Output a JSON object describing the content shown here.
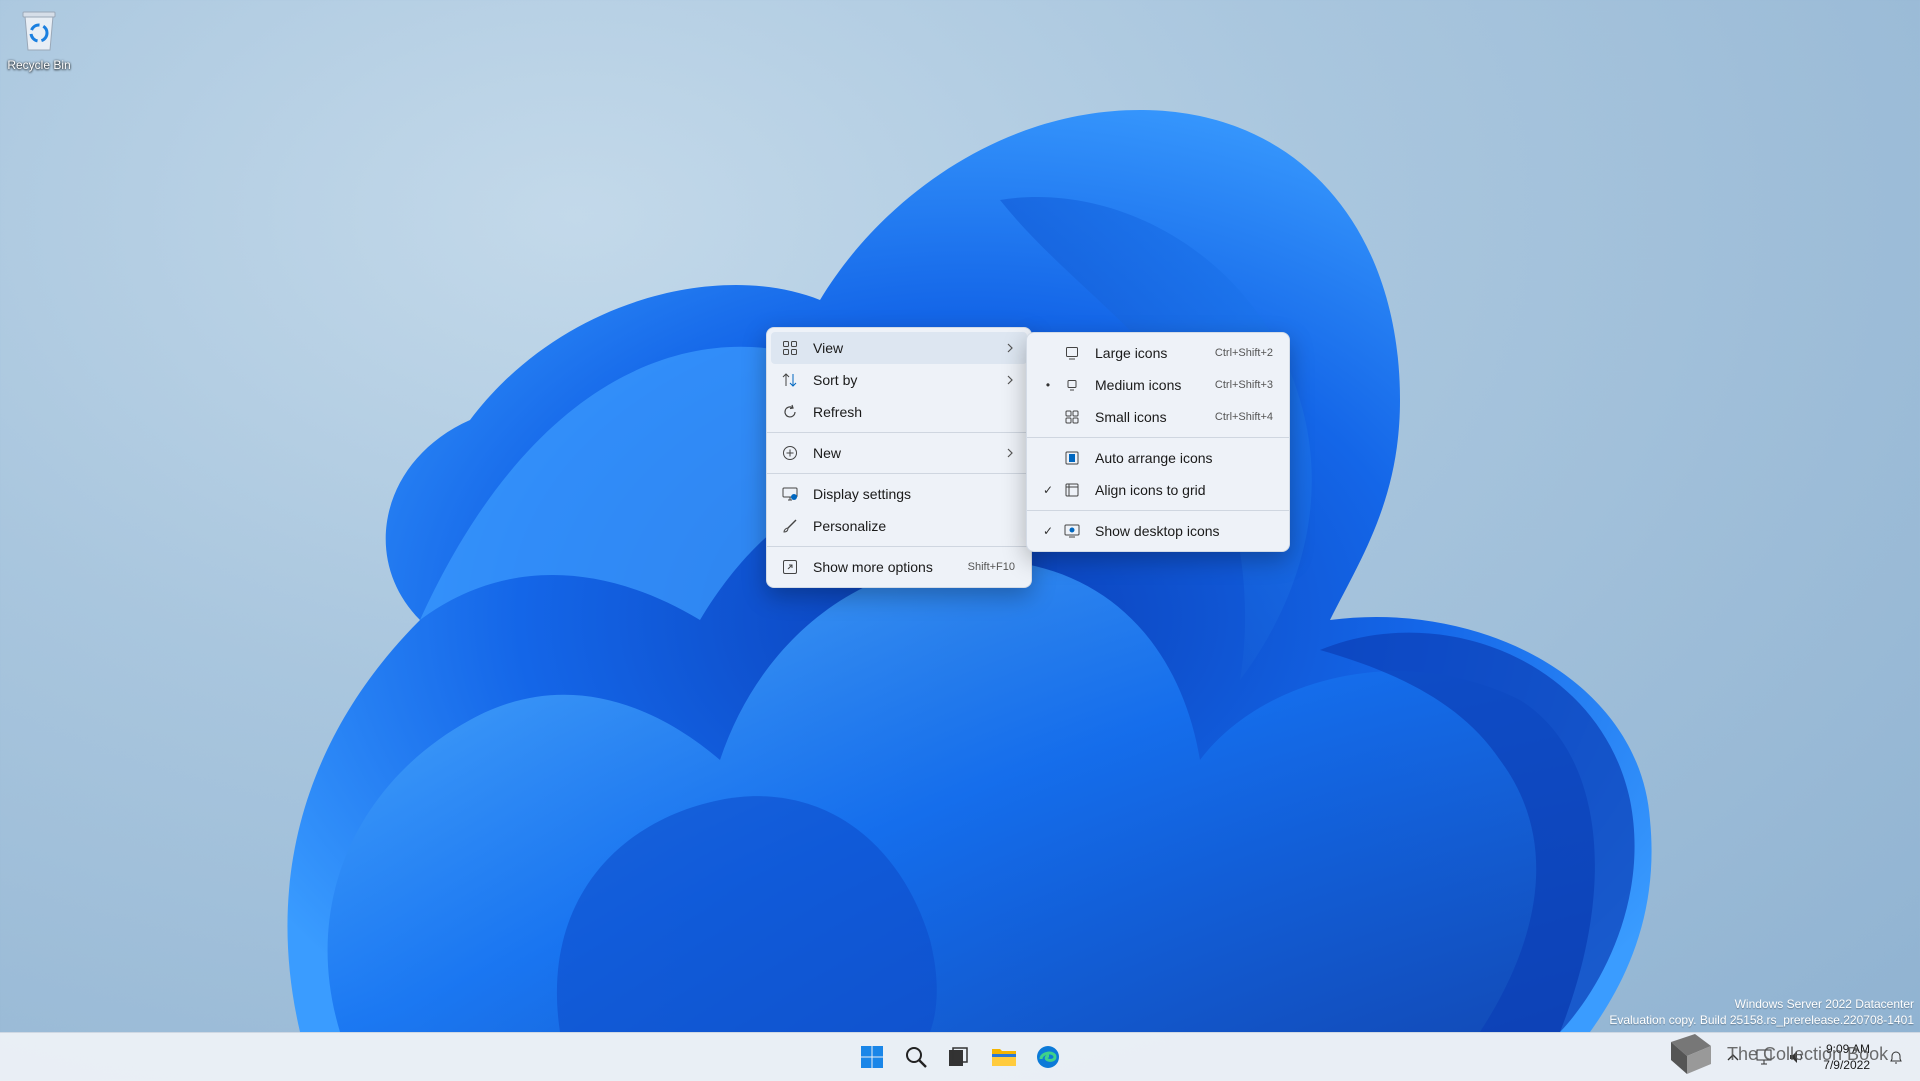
{
  "desktop": {
    "recycle_bin_label": "Recycle Bin"
  },
  "context_menu": {
    "items": [
      {
        "label": "View",
        "icon": "grid-icon",
        "has_submenu": true
      },
      {
        "label": "Sort by",
        "icon": "sort-icon",
        "has_submenu": true
      },
      {
        "label": "Refresh",
        "icon": "refresh-icon",
        "has_submenu": false
      },
      {
        "label": "New",
        "icon": "plus-circle-icon",
        "has_submenu": true
      },
      {
        "label": "Display settings",
        "icon": "display-icon",
        "has_submenu": false
      },
      {
        "label": "Personalize",
        "icon": "brush-icon",
        "has_submenu": false
      },
      {
        "label": "Show more options",
        "icon": "expand-icon",
        "shortcut": "Shift+F10"
      }
    ]
  },
  "view_submenu": {
    "items": [
      {
        "label": "Large icons",
        "shortcut": "Ctrl+Shift+2",
        "mark": "",
        "icon": "large-icons-icon"
      },
      {
        "label": "Medium icons",
        "shortcut": "Ctrl+Shift+3",
        "mark": "•",
        "icon": "medium-icons-icon"
      },
      {
        "label": "Small icons",
        "shortcut": "Ctrl+Shift+4",
        "mark": "",
        "icon": "small-icons-icon"
      },
      {
        "label": "Auto arrange icons",
        "mark": "",
        "icon": "auto-arrange-icon"
      },
      {
        "label": "Align icons to grid",
        "mark": "✓",
        "icon": "align-grid-icon"
      },
      {
        "label": "Show desktop icons",
        "mark": "✓",
        "icon": "show-desktop-icon"
      }
    ]
  },
  "watermark": {
    "line1": "Windows Server 2022 Datacenter",
    "line2": "Evaluation copy. Build 25158.rs_prerelease.220708-1401"
  },
  "taskbar": {
    "apps": [
      "start-icon",
      "search-icon",
      "task-view-icon",
      "file-explorer-icon",
      "edge-icon"
    ],
    "clock_time": "9:09 AM",
    "clock_date": "7/9/2022",
    "brand_text": "The Collection Book"
  },
  "colors": {
    "accent": "#0067c0",
    "menu_bg": "#eef2f8",
    "wallpaper_blue": "#0a5ae6"
  }
}
